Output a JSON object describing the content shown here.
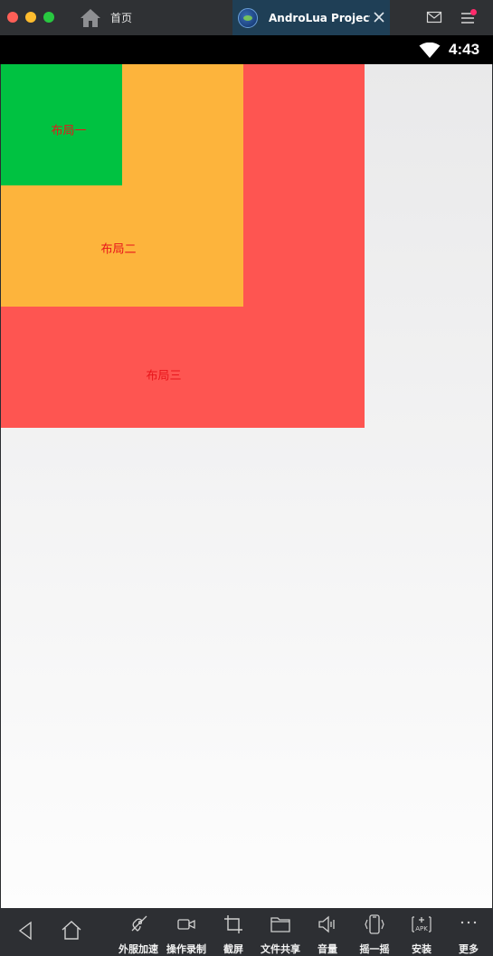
{
  "titlebar": {
    "home_tab_label": "首页",
    "active_tab_label": "AndroLua Project...",
    "colors": {
      "close": "#fe5f57",
      "minimize": "#febc2e",
      "maximize": "#28c840",
      "active_tab_bg": "#1f3f56"
    }
  },
  "statusbar": {
    "time": "4:43",
    "icons": [
      "wifi-icon"
    ]
  },
  "screen": {
    "layouts": [
      {
        "label": "布局三",
        "color": "#fe5551"
      },
      {
        "label": "布局二",
        "color": "#fdb43c"
      },
      {
        "label": "布局一",
        "color": "#00c241"
      }
    ],
    "label_color": "#e8151b"
  },
  "bottombar": {
    "nav": [
      "back-icon",
      "home-icon"
    ],
    "tools": [
      {
        "label": "外服加速",
        "icon": "rocket-icon"
      },
      {
        "label": "操作录制",
        "icon": "video-camera-icon"
      },
      {
        "label": "截屏",
        "icon": "crop-icon"
      },
      {
        "label": "文件共享",
        "icon": "folder-icon"
      },
      {
        "label": "音量",
        "icon": "volume-icon"
      },
      {
        "label": "摇一摇",
        "icon": "shake-icon"
      },
      {
        "label": "安装",
        "icon": "apk-icon"
      },
      {
        "label": "更多",
        "icon": "more-icon"
      }
    ]
  }
}
